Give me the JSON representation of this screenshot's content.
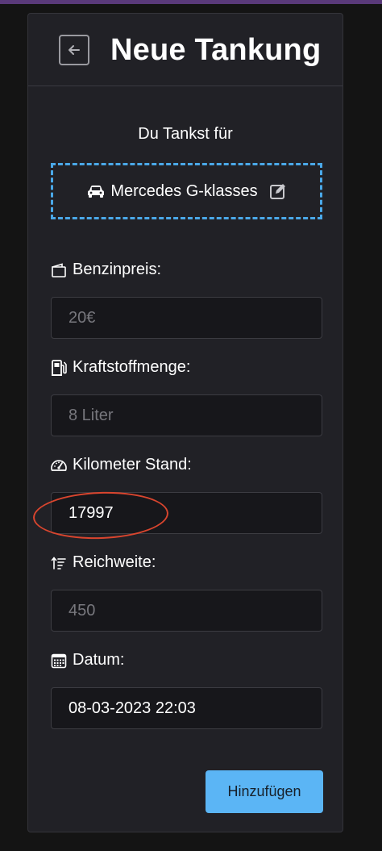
{
  "header": {
    "title": "Neue Tankung",
    "back_icon": "arrow-left-icon"
  },
  "vehicle": {
    "prompt": "Du Tankst für",
    "name": "Mercedes G-klasses",
    "car_icon": "car-icon",
    "edit_icon": "edit-icon",
    "border_color": "#4aa8e8"
  },
  "fields": {
    "price": {
      "label": "Benzinpreis:",
      "placeholder": "20€",
      "icon": "wallet-icon"
    },
    "fuel": {
      "label": "Kraftstoffmenge:",
      "placeholder": "8 Liter",
      "icon": "fuel-pump-icon"
    },
    "odometer": {
      "label": "Kilometer Stand:",
      "value": "17997",
      "icon": "speedometer-icon"
    },
    "range": {
      "label": "Reichweite:",
      "placeholder": "450",
      "icon": "sort-ascending-icon"
    },
    "date": {
      "label": "Datum:",
      "value": "08-03-2023 22:03",
      "icon": "calendar-icon"
    }
  },
  "submit": {
    "label": "Hinzufügen",
    "color": "#5bb5f5"
  },
  "annotation_color": "#d9452e"
}
